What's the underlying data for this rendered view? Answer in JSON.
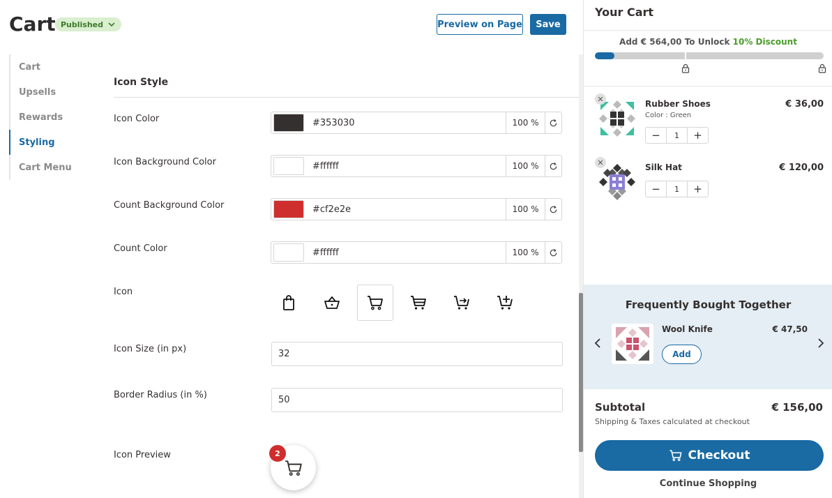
{
  "header": {
    "title": "Cart",
    "status": "Published",
    "preview_label": "Preview on Page",
    "save_label": "Save"
  },
  "sidebar": {
    "items": [
      {
        "label": "Cart"
      },
      {
        "label": "Upsells"
      },
      {
        "label": "Rewards"
      },
      {
        "label": "Styling",
        "active": true
      },
      {
        "label": "Cart Menu"
      }
    ]
  },
  "form": {
    "section_title": "Icon Style",
    "icon_color": {
      "label": "Icon Color",
      "hex": "#353030",
      "opacity": "100 %"
    },
    "icon_bg_color": {
      "label": "Icon Background Color",
      "hex": "#ffffff",
      "opacity": "100 %"
    },
    "count_bg_color": {
      "label": "Count Background Color",
      "hex": "#cf2e2e",
      "opacity": "100 %"
    },
    "count_color": {
      "label": "Count Color",
      "hex": "#ffffff",
      "opacity": "100 %"
    },
    "icon_label": "Icon",
    "icon_options": [
      "bag-icon",
      "basket-icon",
      "cart-icon",
      "cart-filled-icon",
      "cart-arrow-icon",
      "cart-plus-icon"
    ],
    "selected_icon": "cart-icon",
    "icon_size": {
      "label": "Icon Size (in px)",
      "value": "32"
    },
    "border_radius": {
      "label": "Border Radius (in %)",
      "value": "50"
    },
    "preview": {
      "label": "Icon Preview",
      "count": "2"
    }
  },
  "cart": {
    "title": "Your Cart",
    "unlock_prefix": "Add € 564,00 To Unlock ",
    "unlock_discount": "10% Discount",
    "progress_fraction": 0.085,
    "items": [
      {
        "name": "Rubber Shoes",
        "variant": "Color : Green",
        "price": "€ 36,00",
        "qty": "1"
      },
      {
        "name": "Silk Hat",
        "variant": "",
        "price": "€ 120,00",
        "qty": "1"
      }
    ],
    "fbt": {
      "title": "Frequently Bought Together",
      "name": "Wool Knife",
      "price": "€ 47,50",
      "add_label": "Add"
    },
    "subtotal_label": "Subtotal",
    "subtotal_value": "€ 156,00",
    "shipping_note": "Shipping & Taxes calculated at checkout",
    "checkout_label": "Checkout",
    "continue_label": "Continue Shopping"
  },
  "colors": {
    "accent": "#1a6aa3",
    "discount": "#4a9d2a",
    "badge": "#cf2e2e"
  }
}
